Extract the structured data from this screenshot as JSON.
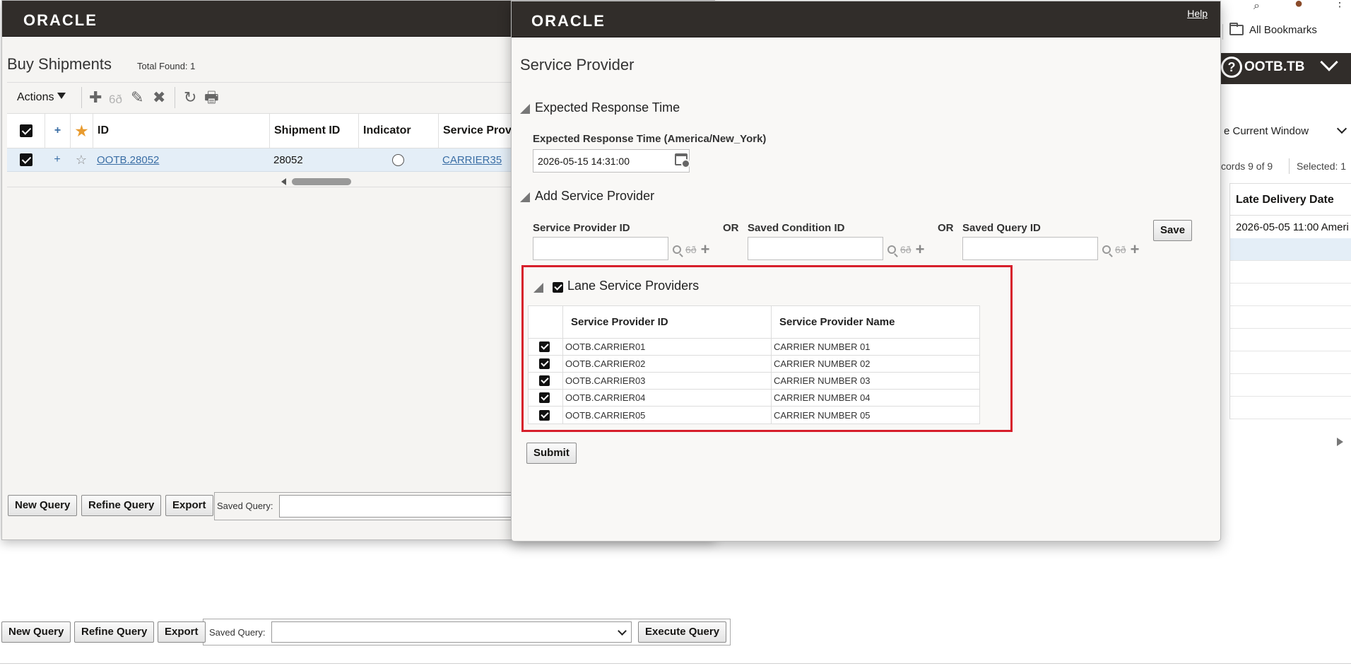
{
  "browser": {
    "bookmarks_label": "All Bookmarks",
    "user_label": "OOTB.TB",
    "help_glyph": "?",
    "open_in_select": "e Current Window",
    "records_text": "cords  9  of  9",
    "selected_text": "Selected: 1",
    "late_delivery_header": "Late Delivery Date",
    "late_delivery_value": "2026-05-05 11:00 Ameri"
  },
  "buy_shipments": {
    "logo": "ORACLE",
    "title": "Buy Shipments",
    "total_found": "Total Found: 1",
    "actions_label": "Actions",
    "columns": {
      "plus": "+",
      "id": "ID",
      "shipment_id": "Shipment ID",
      "indicator": "Indicator",
      "service_provider": "Service Provi"
    },
    "row": {
      "plus": "+",
      "id": "OOTB.28052",
      "shipment_id": "28052",
      "service_provider": "CARRIER35"
    },
    "buttons": {
      "new_query": "New Query",
      "refine_query": "Refine Query",
      "export": "Export"
    },
    "saved_query_label": "Saved Query:"
  },
  "bottom_bar": {
    "new_query": "New Query",
    "refine_query": "Refine Query",
    "export": "Export",
    "saved_query_label": "Saved Query:",
    "execute_query": "Execute Query"
  },
  "service_provider_dialog": {
    "logo": "ORACLE",
    "help": "Help",
    "title": "Service Provider",
    "sections": {
      "expected_response": "Expected Response Time",
      "add_provider": "Add Service Provider",
      "lane_providers": "Lane Service Providers"
    },
    "expected_response_label": "Expected Response Time (America/New_York)",
    "expected_response_value": "2026-05-15 14:31:00",
    "add_fields": {
      "service_provider_id": "Service Provider ID",
      "or1": "OR",
      "saved_condition_id": "Saved Condition ID",
      "or2": "OR",
      "saved_query_id": "Saved Query ID",
      "save_button": "Save"
    },
    "lane_table": {
      "col_id": "Service Provider ID",
      "col_name": "Service Provider Name",
      "rows": [
        {
          "id": "OOTB.CARRIER01",
          "name": "CARRIER NUMBER 01",
          "checked": true
        },
        {
          "id": "OOTB.CARRIER02",
          "name": "CARRIER NUMBER 02",
          "checked": true
        },
        {
          "id": "OOTB.CARRIER03",
          "name": "CARRIER NUMBER 03",
          "checked": true
        },
        {
          "id": "OOTB.CARRIER04",
          "name": "CARRIER NUMBER 04",
          "checked": true
        },
        {
          "id": "OOTB.CARRIER05",
          "name": "CARRIER NUMBER 05",
          "checked": true
        }
      ]
    },
    "submit_button": "Submit"
  },
  "colors": {
    "header_dark": "#312d2a",
    "highlight_red": "#d71f2b",
    "link_blue": "#3a6ea5",
    "row_selected": "#e4eef7"
  }
}
